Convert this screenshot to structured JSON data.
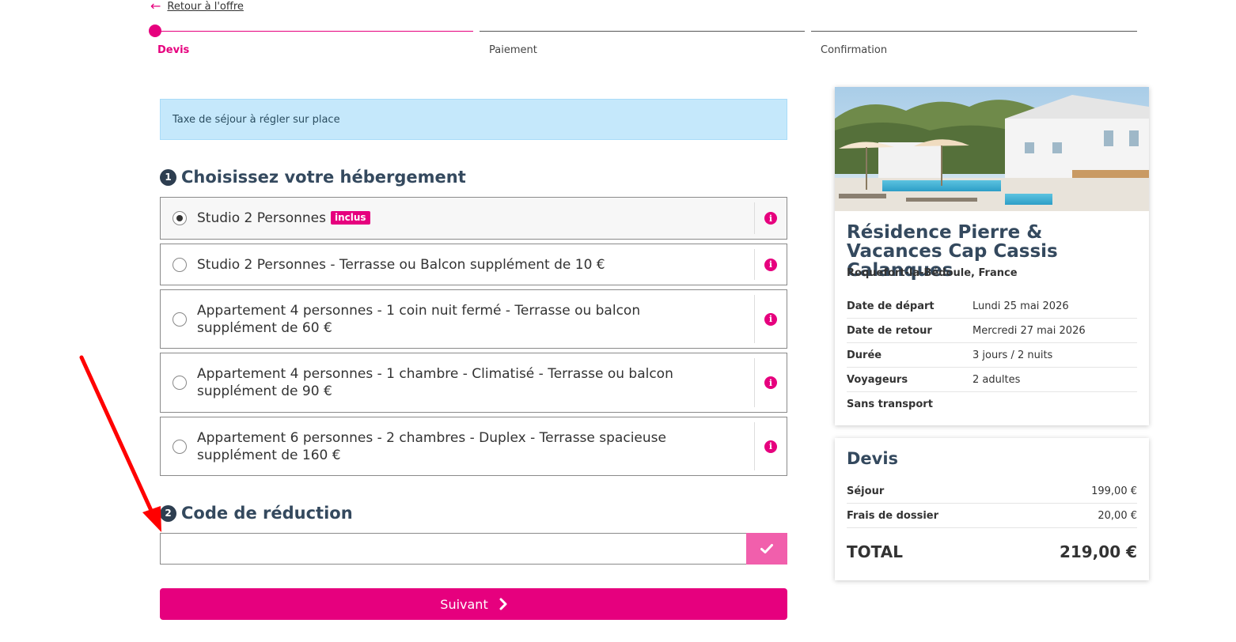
{
  "back_link": {
    "label": "Retour à l'offre"
  },
  "stepper": {
    "steps": [
      {
        "label": "Devis"
      },
      {
        "label": "Paiement"
      },
      {
        "label": "Confirmation"
      }
    ]
  },
  "info_banner": {
    "text": "Taxe de séjour à régler sur place"
  },
  "section_accommodation": {
    "number": "1",
    "title": "Choisissez votre hébergement",
    "options": [
      {
        "label": "Studio 2 Personnes",
        "badge": "inclus",
        "line2": ""
      },
      {
        "label": "Studio 2 Personnes - Terrasse ou Balcon  supplément de 10 €",
        "line2": ""
      },
      {
        "label": "Appartement 4 personnes - 1 coin nuit fermé - Terrasse ou balcon",
        "line2": "supplément de 60 €"
      },
      {
        "label": "Appartement 4 personnes - 1 chambre - Climatisé - Terrasse ou balcon",
        "line2": "supplément de 90 €"
      },
      {
        "label": "Appartement 6 personnes - 2 chambres - Duplex - Terrasse spacieuse",
        "line2": "supplément de 160 €"
      }
    ]
  },
  "section_promo": {
    "number": "2",
    "title": "Code de réduction",
    "input_value": ""
  },
  "next_button": {
    "label": "Suivant"
  },
  "hotel": {
    "title": "Résidence Pierre & Vacances Cap Cassis Calanques",
    "location": "Roquefort-la-Bédoule, France",
    "details": [
      {
        "key": "Date de départ",
        "value": "Lundi 25 mai 2026"
      },
      {
        "key": "Date de retour",
        "value": "Mercredi 27 mai 2026"
      },
      {
        "key": "Durée",
        "value": "3 jours / 2 nuits"
      },
      {
        "key": "Voyageurs",
        "value": "2 adultes"
      },
      {
        "key": "Sans transport",
        "value": ""
      }
    ]
  },
  "quote": {
    "title": "Devis",
    "rows": [
      {
        "key": "Séjour",
        "value": "199,00 €"
      },
      {
        "key": "Frais de dossier",
        "value": "20,00 €"
      }
    ],
    "total_label": "TOTAL",
    "total_value": "219,00 €"
  },
  "colors": {
    "brand": "#e6007e",
    "brand_light": "#f15fac",
    "heading": "#34495e",
    "banner_bg": "#c5e8fb",
    "annotation_arrow": "#ff0000"
  }
}
